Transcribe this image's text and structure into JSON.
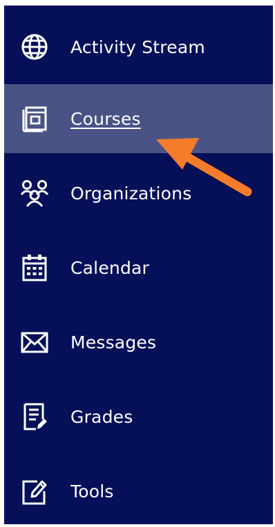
{
  "nav": {
    "items": [
      {
        "label": "Activity Stream",
        "icon": "globe-icon"
      },
      {
        "label": "Courses",
        "icon": "course-book-icon",
        "active": true
      },
      {
        "label": "Organizations",
        "icon": "people-group-icon"
      },
      {
        "label": "Calendar",
        "icon": "calendar-icon"
      },
      {
        "label": "Messages",
        "icon": "envelope-icon"
      },
      {
        "label": "Grades",
        "icon": "grades-icon"
      },
      {
        "label": "Tools",
        "icon": "tools-edit-icon"
      }
    ]
  },
  "colors": {
    "sidebar_bg": "#061059",
    "active_bg": "#4a5385",
    "text": "#ffffff",
    "annotation_arrow": "#f47c2b"
  }
}
